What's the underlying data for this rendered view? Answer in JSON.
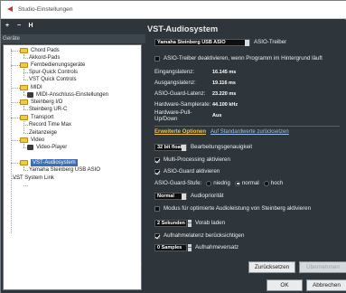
{
  "window": {
    "title": "Studio-Einstellungen"
  },
  "toolbar": {
    "add": "+",
    "remove": "−",
    "reset": "H"
  },
  "left_header": "Geräte",
  "tree": [
    {
      "label": "Chord Pads",
      "icon": "folder-icon"
    },
    {
      "label": "Akkord-Pads",
      "icon": ""
    },
    {
      "label": "Fernbedienungsgeräte",
      "icon": "folder-icon"
    },
    {
      "label": "Spur-Quick Controls",
      "icon": ""
    },
    {
      "label": "VST Quick Controls",
      "icon": ""
    },
    {
      "label": "MIDI",
      "icon": "folder-icon"
    },
    {
      "label": "MIDI-Anschluss-Einstellungen",
      "icon": "midi-port-icon"
    },
    {
      "label": "Steinberg I/O",
      "icon": "folder-icon"
    },
    {
      "label": "Steinberg UR-C",
      "icon": ""
    },
    {
      "label": "Transport",
      "icon": "folder-icon"
    },
    {
      "label": "Record Time Max",
      "icon": ""
    },
    {
      "label": "Zeitanzeige",
      "icon": ""
    },
    {
      "label": "Video",
      "icon": "folder-icon"
    },
    {
      "label": "Video-Player",
      "icon": "video-player-icon"
    },
    {
      "label": "VST-Audiosystem",
      "icon": "folder-icon",
      "selected": true
    },
    {
      "label": "Yamaha Steinberg USB ASIO",
      "icon": ""
    },
    {
      "label": "VST System Link",
      "icon": ""
    }
  ],
  "panel": {
    "heading": "VST-Audiosystem",
    "driver_value": "Yamaha Steinberg USB ASIO",
    "driver_label": "ASIO-Treiber",
    "deactivate_label": "ASIO-Treiber deaktivieren, wenn Programm im Hintergrund läuft",
    "info": [
      {
        "label": "Eingangslatenz:",
        "value": "16.145 ms"
      },
      {
        "label": "Ausgangslatenz:",
        "value": "19.116 ms"
      },
      {
        "label": "ASIO-Guard-Latenz:",
        "value": "23.220 ms"
      },
      {
        "label": "Hardware-Samplerate:",
        "value": "44.100 kHz"
      },
      {
        "label": "Hardware-Pull-Up/Down",
        "value": "Aus"
      }
    ],
    "tab_active": "Erweiterte Optionen",
    "tab_link": "Auf Standardwerte zurücksetzen",
    "precision_value": "32 bit float",
    "precision_label": "Bearbeitungsgenauigkeit",
    "multiproc_label": "Multi-Processing aktivieren",
    "asioguard_label": "ASIO-Guard aktivieren",
    "guard_level_label": "ASIO-Guard-Stufe:",
    "guard_levels": [
      "niedrig",
      "normal",
      "hoch"
    ],
    "guard_selected": "normal",
    "priority_value": "Normal",
    "priority_label": "Audiopriorität",
    "optimized_label": "Modus für optimierte Audioleistung von Steinberg aktivieren",
    "preload_value": "2 Sekunden",
    "preload_label": "Vorab laden",
    "latency_comp_label": "Aufnahmelatenz berücksichtigen",
    "offset_value": "0 Samples",
    "offset_label": "Aufnahmeversatz",
    "reset_button": "Zurücksetzen",
    "apply_button": "Übernehmen",
    "ok_button": "OK",
    "cancel_button": "Abbrechen"
  },
  "colors": {
    "panel_bg": "#2f363b",
    "accent_tab": "#f0c04a",
    "link": "#9bc1f0",
    "selection": "#3a6fb3"
  }
}
